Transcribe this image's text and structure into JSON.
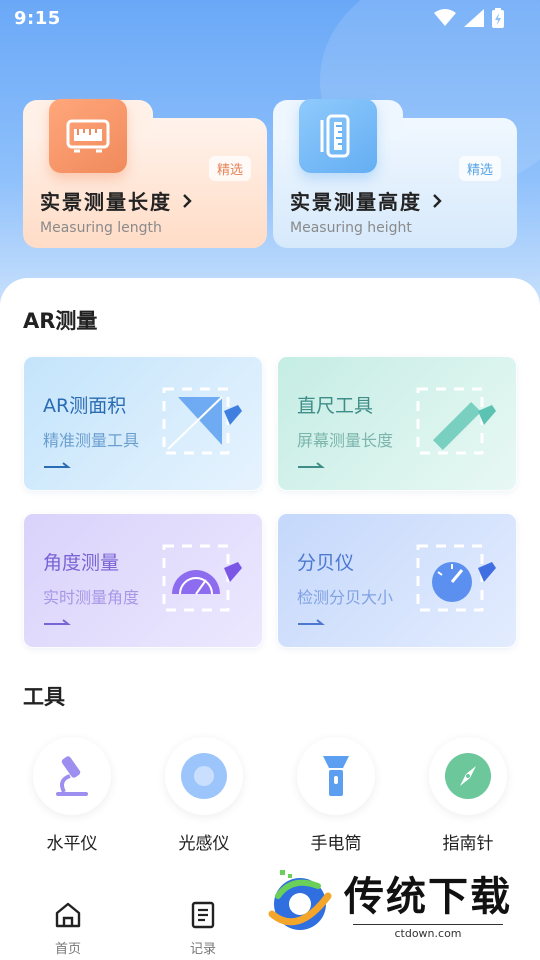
{
  "status": {
    "time": "9:15"
  },
  "features": [
    {
      "title": "实景测量长度",
      "subtitle": "Measuring length",
      "badge": "精选"
    },
    {
      "title": "实景测量高度",
      "subtitle": "Measuring height",
      "badge": "精选"
    }
  ],
  "ar_section": {
    "title": "AR测量",
    "cards": [
      {
        "title": "AR测面积",
        "subtitle": "精准测量工具"
      },
      {
        "title": "直尺工具",
        "subtitle": "屏幕测量长度"
      },
      {
        "title": "角度测量",
        "subtitle": "实时测量角度"
      },
      {
        "title": "分贝仪",
        "subtitle": "检测分贝大小"
      }
    ]
  },
  "tools_section": {
    "title": "工具",
    "items": [
      {
        "label": "水平仪",
        "icon": "microscope-icon"
      },
      {
        "label": "光感仪",
        "icon": "light-sensor-icon"
      },
      {
        "label": "手电筒",
        "icon": "flashlight-icon"
      },
      {
        "label": "指南针",
        "icon": "compass-icon"
      }
    ]
  },
  "nav": {
    "items": [
      {
        "label": "首页",
        "icon": "home-icon"
      },
      {
        "label": "记录",
        "icon": "document-icon"
      }
    ]
  },
  "watermark": {
    "text": "传统下载",
    "url": "ctdown.com"
  }
}
